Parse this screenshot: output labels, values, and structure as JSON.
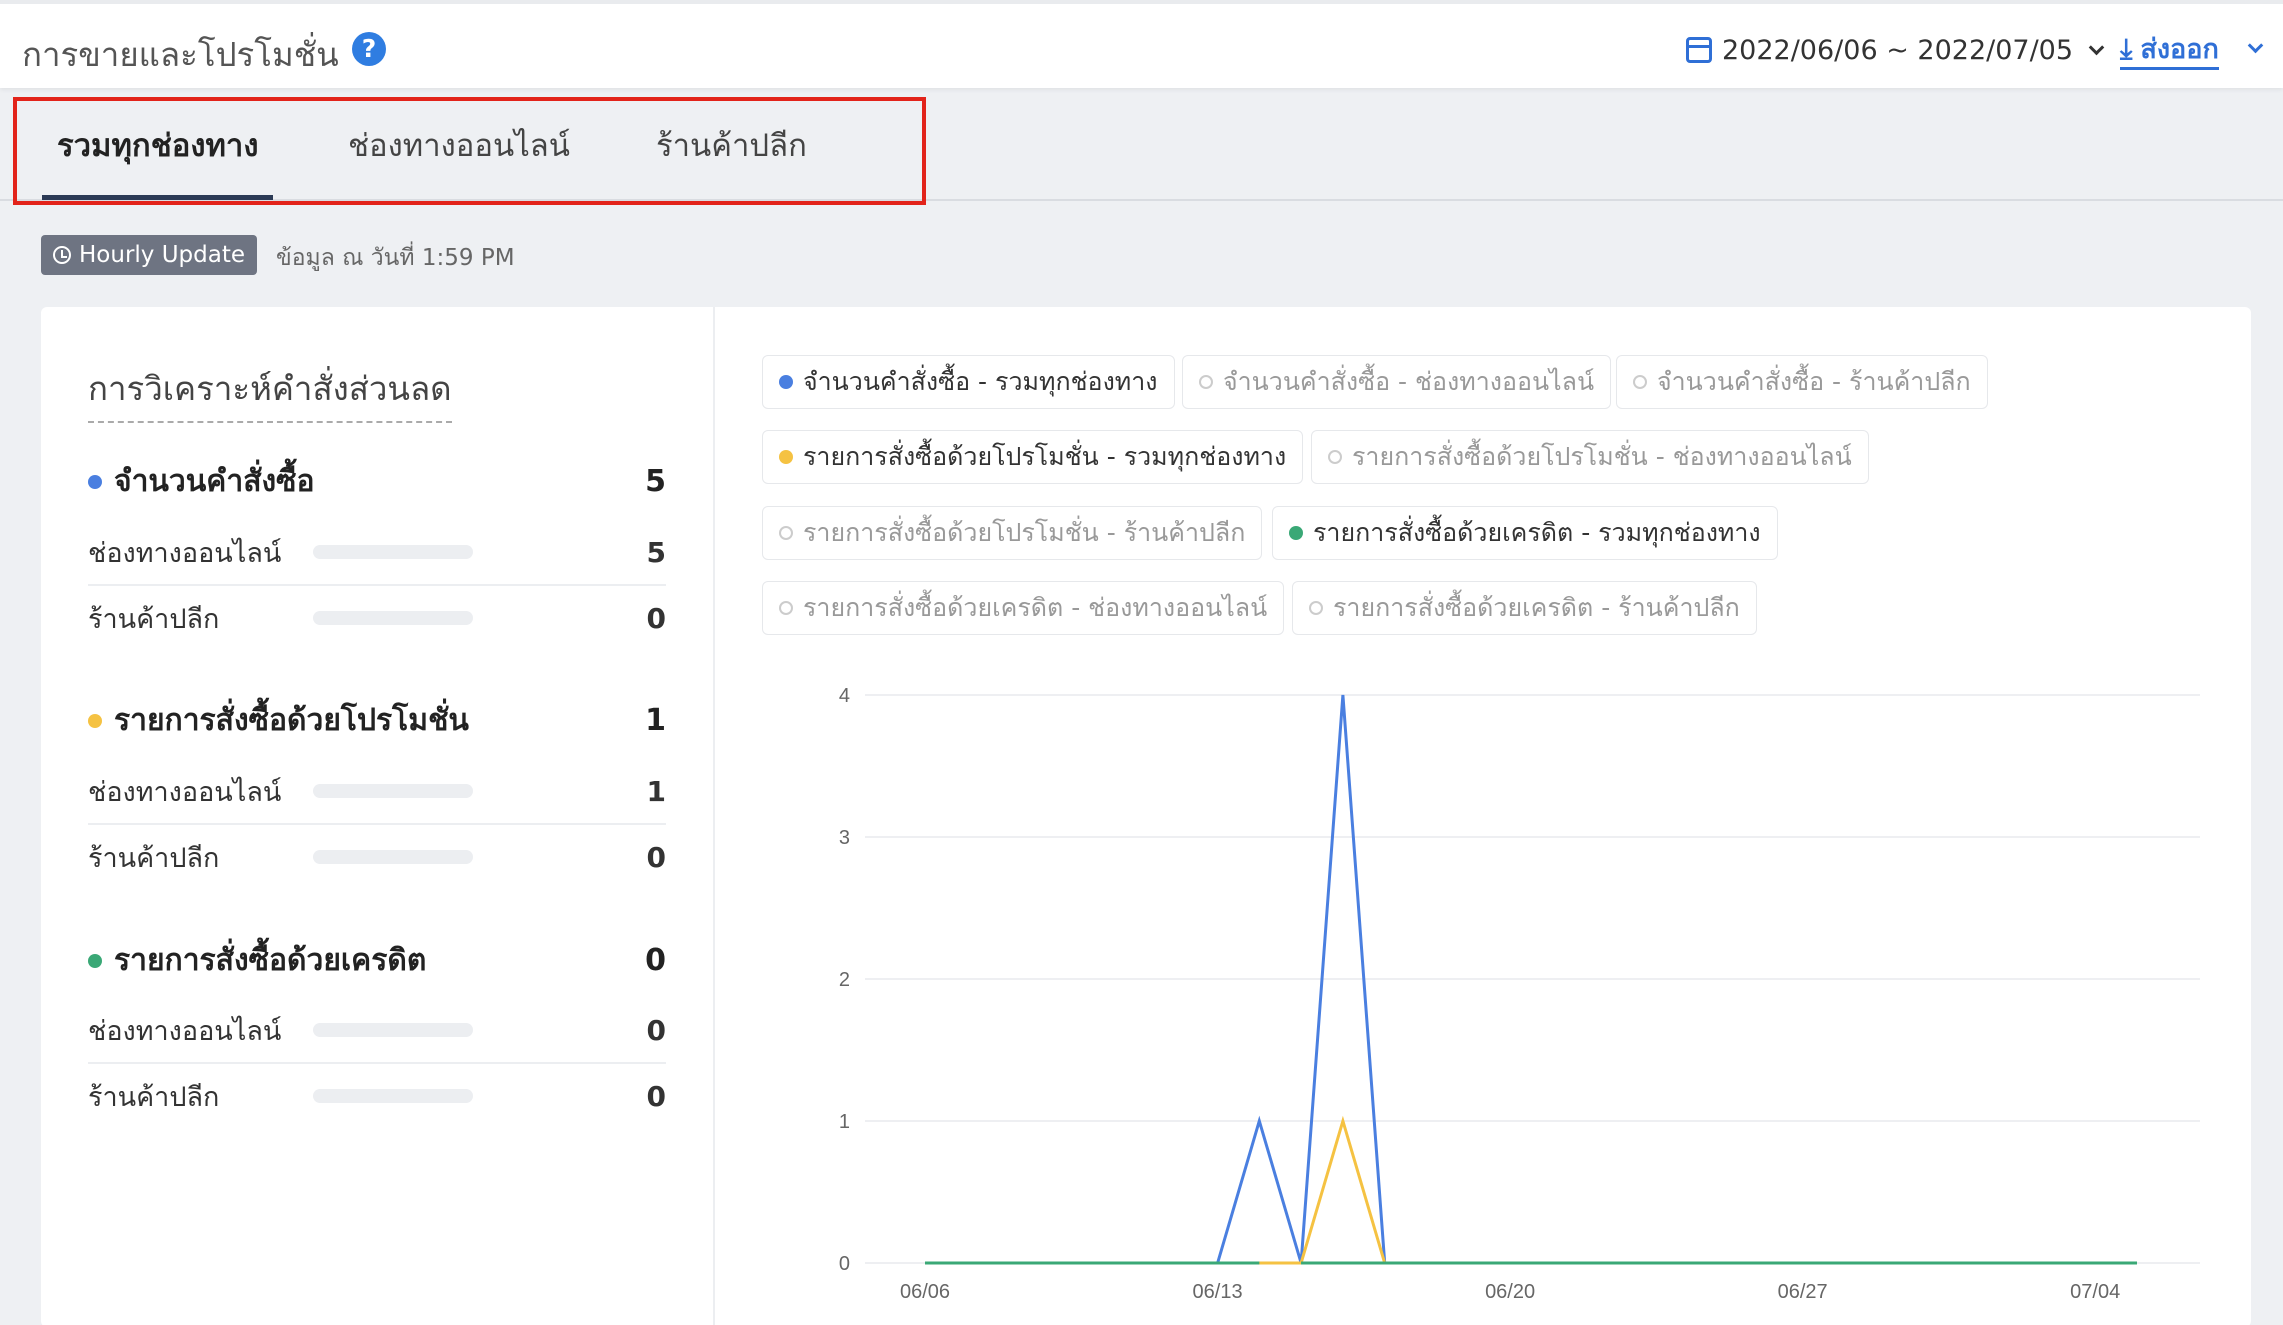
{
  "header": {
    "title": "การขายและโปรโมชั่น",
    "help_glyph": "?",
    "date_range": "2022/06/06 ~ 2022/07/05",
    "export_label": "ส่งออก"
  },
  "tabs": [
    {
      "label": "รวมทุกช่องทาง",
      "active": true
    },
    {
      "label": "ช่องทางออนไลน์",
      "active": false
    },
    {
      "label": "ร้านค้าปลีก",
      "active": false
    }
  ],
  "update": {
    "badge": "Hourly Update",
    "as_of": "ข้อมูล ณ วันที่ 1:59 PM"
  },
  "panel": {
    "title": "การวิเคราะห์คำสั่งส่วนลด",
    "metrics": [
      {
        "label": "จำนวนคำสั่งซื้อ",
        "value": "5",
        "color": "#4a7fe0",
        "rows": [
          {
            "label": "ช่องทางออนไลน์",
            "value": "5",
            "fill": 1.0,
            "color": "#2f5fb3"
          },
          {
            "label": "ร้านค้าปลีก",
            "value": "0",
            "fill": 0,
            "color": "#2f5fb3"
          }
        ]
      },
      {
        "label": "รายการสั่งซื้อด้วยโปรโมชั่น",
        "value": "1",
        "color": "#f5c242",
        "rows": [
          {
            "label": "ช่องทางออนไลน์",
            "value": "1",
            "fill": 1.0,
            "color": "#f4a460"
          },
          {
            "label": "ร้านค้าปลีก",
            "value": "0",
            "fill": 0,
            "color": "#f4a460"
          }
        ]
      },
      {
        "label": "รายการสั่งซื้อด้วยเครดิต",
        "value": "0",
        "color": "#3aa876",
        "rows": [
          {
            "label": "ช่องทางออนไลน์",
            "value": "0",
            "fill": 0,
            "color": "#3aa876"
          },
          {
            "label": "ร้านค้าปลีก",
            "value": "0",
            "fill": 0,
            "color": "#3aa876"
          }
        ]
      }
    ]
  },
  "legend": [
    {
      "label": "จำนวนคำสั่งซื้อ - รวมทุกช่องทาง",
      "on": true,
      "color": "#4a7fe0"
    },
    {
      "label": "จำนวนคำสั่งซื้อ - ช่องทางออนไลน์",
      "on": false
    },
    {
      "label": "จำนวนคำสั่งซื้อ - ร้านค้าปลีก",
      "on": false
    },
    {
      "label": "รายการสั่งซื้อด้วยโปรโมชั่น - รวมทุกช่องทาง",
      "on": true,
      "color": "#f5c242"
    },
    {
      "label": "รายการสั่งซื้อด้วยโปรโมชั่น - ช่องทางออนไลน์",
      "on": false
    },
    {
      "label": "รายการสั่งซื้อด้วยโปรโมชั่น - ร้านค้าปลีก",
      "on": false
    },
    {
      "label": "รายการสั่งซื้อด้วยเครดิต - รวมทุกช่องทาง",
      "on": true,
      "color": "#3aa876"
    },
    {
      "label": "รายการสั่งซื้อด้วยเครดิต - ช่องทางออนไลน์",
      "on": false
    },
    {
      "label": "รายการสั่งซื้อด้วยเครดิต - ร้านค้าปลีก",
      "on": false
    }
  ],
  "chart_data": {
    "type": "line",
    "x": [
      "06/06",
      "06/07",
      "06/08",
      "06/09",
      "06/10",
      "06/11",
      "06/12",
      "06/13",
      "06/14",
      "06/15",
      "06/16",
      "06/17",
      "06/18",
      "06/19",
      "06/20",
      "06/21",
      "06/22",
      "06/23",
      "06/24",
      "06/25",
      "06/26",
      "06/27",
      "06/28",
      "06/29",
      "06/30",
      "07/01",
      "07/02",
      "07/03",
      "07/04",
      "07/05"
    ],
    "xticks": [
      "06/06",
      "06/13",
      "06/20",
      "06/27",
      "07/04"
    ],
    "yticks": [
      "0",
      "1",
      "2",
      "3",
      "4"
    ],
    "ylim": [
      0,
      4
    ],
    "grid": true,
    "series": [
      {
        "name": "จำนวนคำสั่งซื้อ - รวมทุกช่องทาง",
        "color": "#4a7fe0",
        "values": [
          0,
          0,
          0,
          0,
          0,
          0,
          0,
          0,
          1,
          0,
          4,
          0,
          0,
          0,
          0,
          0,
          0,
          0,
          0,
          0,
          0,
          0,
          0,
          0,
          0,
          0,
          0,
          0,
          0,
          0
        ]
      },
      {
        "name": "รายการสั่งซื้อด้วยโปรโมชั่น - รวมทุกช่องทาง",
        "color": "#f5c242",
        "values": [
          0,
          0,
          0,
          0,
          0,
          0,
          0,
          0,
          0,
          0,
          1,
          0,
          0,
          0,
          0,
          0,
          0,
          0,
          0,
          0,
          0,
          0,
          0,
          0,
          0,
          0,
          0,
          0,
          0,
          0
        ]
      },
      {
        "name": "รายการสั่งซื้อด้วยเครดิต - รวมทุกช่องทาง",
        "color": "#3aa876",
        "values": [
          0,
          0,
          0,
          0,
          0,
          0,
          0,
          0,
          0,
          0,
          0,
          0,
          0,
          0,
          0,
          0,
          0,
          0,
          0,
          0,
          0,
          0,
          0,
          0,
          0,
          0,
          0,
          0,
          0,
          0
        ]
      }
    ]
  }
}
